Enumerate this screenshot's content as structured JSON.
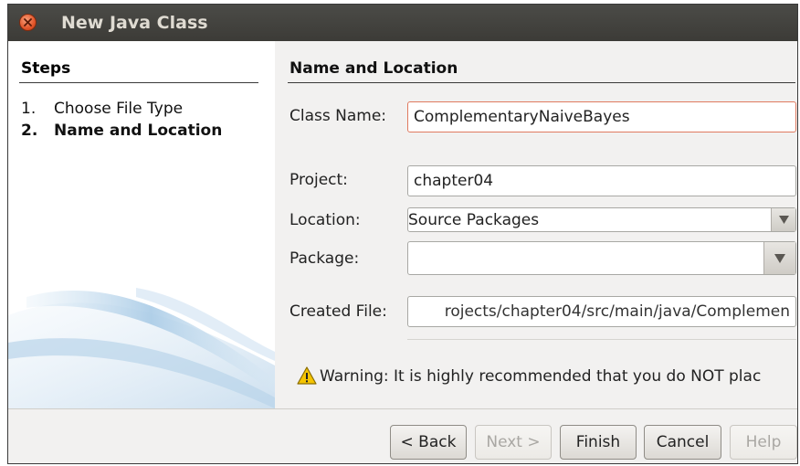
{
  "window": {
    "title": "New Java Class"
  },
  "steps": {
    "heading": "Steps",
    "items": [
      {
        "number": "1.",
        "label": "Choose File Type",
        "current": false
      },
      {
        "number": "2.",
        "label": "Name and Location",
        "current": true
      }
    ]
  },
  "panel": {
    "heading": "Name and Location",
    "class_name": {
      "label": "Class Name:",
      "mnemonic": "N",
      "value": "ComplementaryNaiveBayes"
    },
    "project": {
      "label": "Project:",
      "mnemonic": "P",
      "value": "chapter04"
    },
    "location": {
      "label": "Location:",
      "mnemonic": "L",
      "value": "Source Packages"
    },
    "package": {
      "label": "Package:",
      "mnemonic": "k",
      "value": ""
    },
    "created_file": {
      "label": "Created File:",
      "mnemonic": "C",
      "value": "rojects/chapter04/src/main/java/Complemen"
    },
    "warning": "Warning: It is highly recommended that you do NOT plac"
  },
  "buttons": {
    "back": "< Back",
    "next": "Next >",
    "finish": "Finish",
    "cancel": "Cancel",
    "help": "Help"
  },
  "icons": {
    "close": "close-icon",
    "dropdown": "chevron-down-icon",
    "warning": "warning-icon"
  },
  "colors": {
    "titlebar": "#3c3b37",
    "close_button": "#e2552a",
    "focus_border": "#e07a5f",
    "warning_yellow": "#f5c400"
  }
}
